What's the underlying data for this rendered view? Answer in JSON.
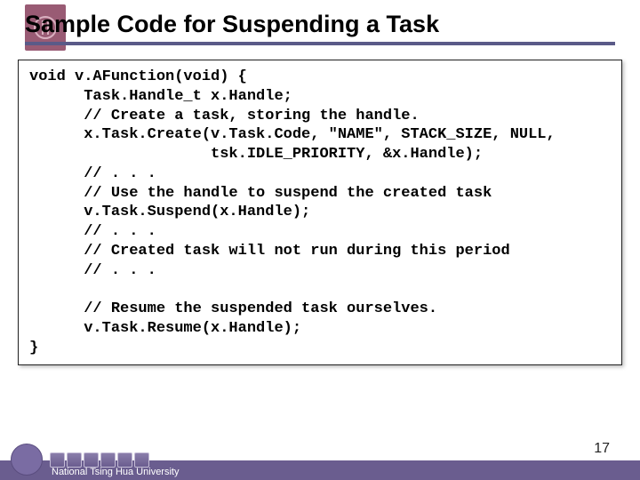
{
  "title": "Sample Code for Suspending a Task",
  "code": "void v.AFunction(void) {\n      Task.Handle_t x.Handle;\n      // Create a task, storing the handle.\n      x.Task.Create(v.Task.Code, \"NAME\", STACK_SIZE, NULL,\n                    tsk.IDLE_PRIORITY, &x.Handle);\n      // . . .\n      // Use the handle to suspend the created task\n      v.Task.Suspend(x.Handle);\n      // . . .\n      // Created task will not run during this period\n      // . . .\n\n      // Resume the suspended task ourselves.\n      v.Task.Resume(x.Handle);\n}",
  "footer": {
    "university": "National Tsing Hua University",
    "page": "17"
  }
}
